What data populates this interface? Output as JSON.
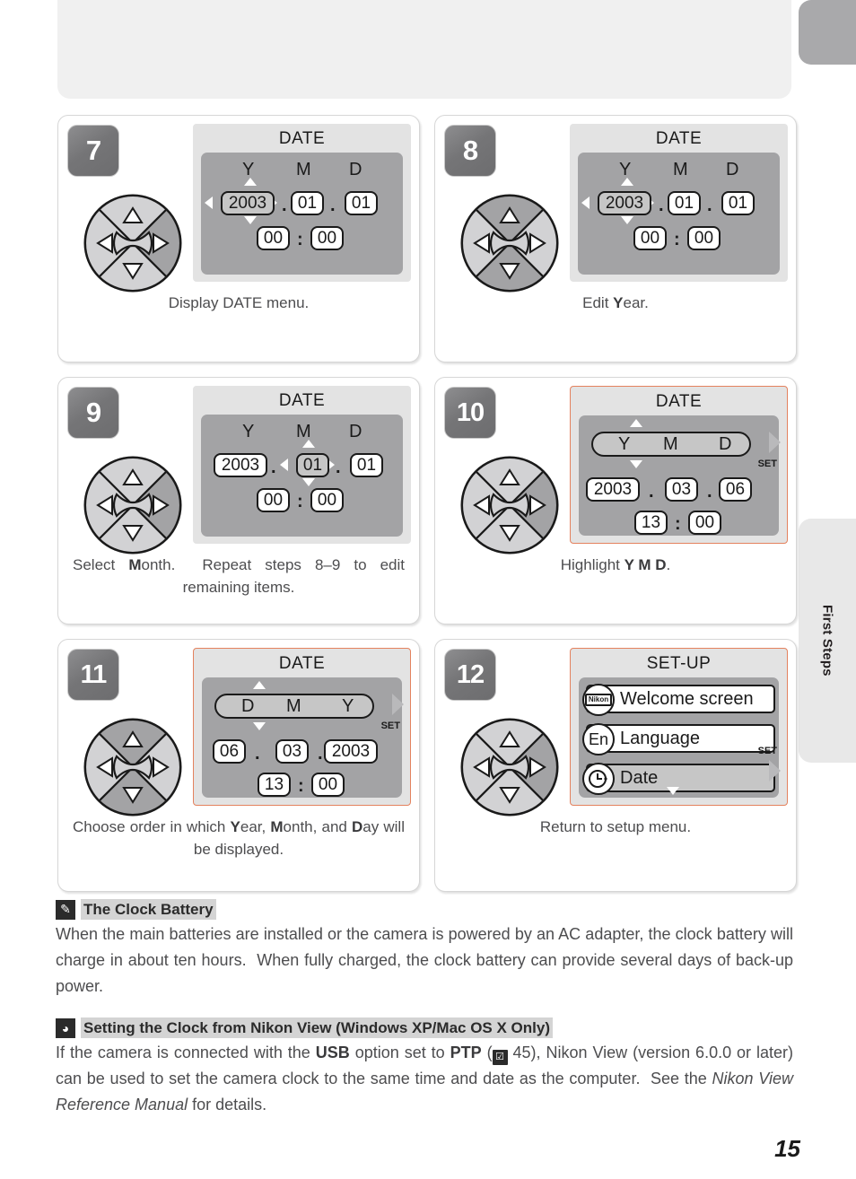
{
  "page": {
    "number": "15",
    "chapter_tab": "First Steps"
  },
  "steps": [
    {
      "number": "7",
      "caption_html": "Display DATE menu.",
      "caption_plain": "Display DATE menu.",
      "screen": {
        "title": "DATE",
        "type": "date-edit",
        "framed": false,
        "headers": [
          "Y",
          "M",
          "D"
        ],
        "year": "2003",
        "month": "01",
        "day": "01",
        "hour": "00",
        "minute": "00",
        "selected_field": "year",
        "arrows": [
          "up",
          "down",
          "left",
          "right"
        ],
        "set_label": ""
      },
      "dpad_highlight": [
        "right"
      ]
    },
    {
      "number": "8",
      "caption_html": "Edit <b>Y</b>ear.",
      "caption_plain": "Edit Year.",
      "screen": {
        "title": "DATE",
        "type": "date-edit",
        "framed": false,
        "headers": [
          "Y",
          "M",
          "D"
        ],
        "year": "2003",
        "month": "01",
        "day": "01",
        "hour": "00",
        "minute": "00",
        "selected_field": "year",
        "arrows": [
          "up",
          "down",
          "left",
          "right"
        ],
        "set_label": ""
      },
      "dpad_highlight": [
        "up",
        "down"
      ]
    },
    {
      "number": "9",
      "caption_html": "Select <b>M</b>onth.&nbsp; Repeat steps 8–9 to edit remaining items.",
      "caption_plain": "Select Month. Repeat steps 8–9 to edit remaining items.",
      "screen": {
        "title": "DATE",
        "type": "date-edit",
        "framed": false,
        "headers": [
          "Y",
          "M",
          "D"
        ],
        "year": "2003",
        "month": "01",
        "day": "01",
        "hour": "00",
        "minute": "00",
        "selected_field": "month",
        "arrows": [
          "up",
          "down",
          "left",
          "right"
        ],
        "set_label": ""
      },
      "dpad_highlight": [
        "right"
      ]
    },
    {
      "number": "10",
      "caption_html": "Highlight <b>Y M D</b>.",
      "caption_plain": "Highlight Y M D.",
      "screen": {
        "title": "DATE",
        "type": "order-edit",
        "framed": true,
        "order": [
          "Y",
          "M",
          "D"
        ],
        "year": "2003",
        "month": "03",
        "day": "06",
        "hour": "13",
        "minute": "00",
        "value_order": [
          "2003",
          "03",
          "06"
        ],
        "arrows": [
          "up",
          "down"
        ],
        "set_label": "SET"
      },
      "dpad_highlight": [
        "right"
      ]
    },
    {
      "number": "11",
      "caption_html": "Choose order in which <b>Y</b>ear, <b>M</b>onth, and <b>D</b>ay will be displayed.",
      "caption_plain": "Choose order in which Year, Month, and Day will be displayed.",
      "screen": {
        "title": "DATE",
        "type": "order-edit",
        "framed": true,
        "order": [
          "D",
          "M",
          "Y"
        ],
        "year": "2003",
        "month": "03",
        "day": "06",
        "hour": "13",
        "minute": "00",
        "value_order": [
          "06",
          "03",
          "2003"
        ],
        "arrows": [
          "up",
          "down"
        ],
        "set_label": "SET"
      },
      "dpad_highlight": [
        "up",
        "down"
      ]
    },
    {
      "number": "12",
      "caption_html": "Return to setup menu.",
      "caption_plain": "Return to setup menu.",
      "screen": {
        "title": "SET-UP",
        "type": "setup-menu",
        "framed": true,
        "set_label": "SET",
        "items": [
          {
            "icon": "nikon-logo-icon",
            "icon_text": "Nikon",
            "label": "Welcome screen",
            "highlighted": false
          },
          {
            "icon": "language-en-icon",
            "icon_text": "En",
            "label": "Language",
            "highlighted": false
          },
          {
            "icon": "clock-icon",
            "icon_text": "◔",
            "label": "Date",
            "highlighted": true
          }
        ],
        "scroll_down": true
      },
      "dpad_highlight": [
        "right"
      ]
    }
  ],
  "notes": [
    {
      "icon": "pencil-icon",
      "icon_glyph": "✎",
      "title": "The Clock Battery",
      "body_html": "When the main batteries are installed or the camera is powered by an AC adapter, the clock battery will charge in about ten hours.&nbsp; When fully charged, the clock battery can provide several days of back-up power.",
      "body_plain": "When the main batteries are installed or the camera is powered by an AC adapter, the clock battery will charge in about ten hours. When fully charged, the clock battery can provide several days of back-up power."
    },
    {
      "icon": "tip-lightbulb-icon",
      "icon_glyph": "◕",
      "title": "Setting the Clock from Nikon View (Windows XP/Mac OS X Only)",
      "body_html": "If the camera is connected with the <b>USB</b> option set to <b>PTP</b> (<span class=\"ref-ic\" data-name=\"page-reference-icon\" data-interactable=\"false\">☑</span> 45), Nikon View (version 6.0.0 or later) can be used to set the camera clock to the same time and date as the computer.&nbsp; See the <i>Nikon View Reference Manual</i> for details.",
      "body_plain": "If the camera is connected with the USB option set to PTP (45), Nikon View (version 6.0.0 or later) can be used to set the camera clock to the same time and date as the computer. See the Nikon View Reference Manual for details."
    }
  ],
  "colors": {
    "accent_frame": "#e4825e",
    "lcd_body": "#a3a3a5",
    "lcd_bezel": "#e3e3e3",
    "badge": "#757577",
    "note_title_bg": "#d4d4d4",
    "body_text": "#4d4d4f"
  }
}
